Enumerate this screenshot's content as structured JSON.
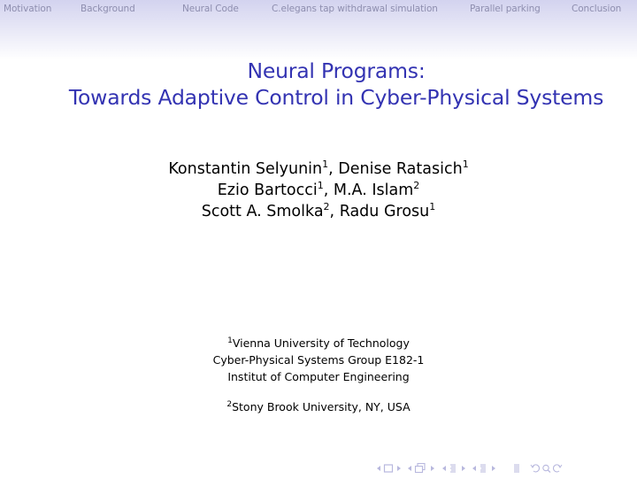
{
  "header": {
    "nav_items": [
      {
        "label": "Motivation"
      },
      {
        "label": "Background"
      },
      {
        "label": "Neural Code"
      },
      {
        "label": "C.elegans tap withdrawal simulation"
      },
      {
        "label": "Parallel parking"
      },
      {
        "label": "Conclusion"
      }
    ]
  },
  "slide": {
    "title_line1": "Neural Programs:",
    "title_line2": "Towards Adaptive Control in Cyber-Physical Systems",
    "authors": [
      {
        "name": "Konstantin Selyunin",
        "affil": "1"
      },
      {
        "name": "Denise Ratasich",
        "affil": "1"
      },
      {
        "name": "Ezio Bartocci",
        "affil": "1"
      },
      {
        "name": "M.A. Islam",
        "affil": "2"
      },
      {
        "name": "Scott A. Smolka",
        "affil": "2"
      },
      {
        "name": "Radu Grosu",
        "affil": "1"
      }
    ],
    "separator": ", ",
    "affiliations": {
      "first": {
        "mark": "1",
        "line1": "Vienna University of Technology",
        "line2": "Cyber-Physical Systems Group E182-1",
        "line3": "Institut of Computer Engineering"
      },
      "second": {
        "mark": "2",
        "line1": "Stony Brook University, NY, USA"
      }
    }
  },
  "beamer_nav": {
    "icons": [
      "nav-frame-prev",
      "nav-frame",
      "nav-frame-next",
      "nav-subsection-prev",
      "nav-subsection",
      "nav-subsection-next",
      "nav-section-prev",
      "nav-section",
      "nav-section-next",
      "nav-document",
      "nav-back",
      "nav-search",
      "nav-forward"
    ],
    "color": "#b8b8de"
  },
  "colors": {
    "title": "#3333b2",
    "nav_text": "#8e8eaf",
    "header_top": "#d3d3ef"
  }
}
